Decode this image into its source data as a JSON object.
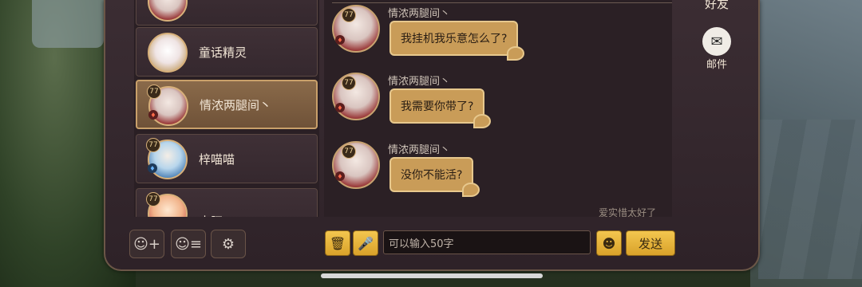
{
  "friends": [
    {
      "name": "",
      "level": "",
      "element": "",
      "avatar": "knight"
    },
    {
      "name": "童话精灵",
      "level": "",
      "element": "",
      "avatar": "bunny"
    },
    {
      "name": "情浓两腿间丶",
      "level": "77",
      "element": "fire",
      "avatar": "knight",
      "selected": true
    },
    {
      "name": "梓喵喵",
      "level": "77",
      "element": "water",
      "avatar": "blue"
    },
    {
      "name": "水豚",
      "level": "77",
      "element": "",
      "avatar": "pink"
    }
  ],
  "messages": [
    {
      "sender": "情浓两腿间丶",
      "text": "我挂机我乐意怎么了?",
      "level": "77"
    },
    {
      "sender": "情浓两腿间丶",
      "text": "我需要你带了?",
      "level": "77"
    },
    {
      "sender": "情浓两腿间丶",
      "text": "没你不能活?",
      "level": "77"
    }
  ],
  "own_message_peek": "爱实惜太好了",
  "side": {
    "friends_label": "好友",
    "mail_label": "邮件"
  },
  "input": {
    "placeholder": "可以输入50字"
  },
  "send_label": "发送",
  "colors": {
    "accent_gold": "#d9a22a",
    "panel": "#2e2228",
    "bubble": "#c99c58"
  }
}
